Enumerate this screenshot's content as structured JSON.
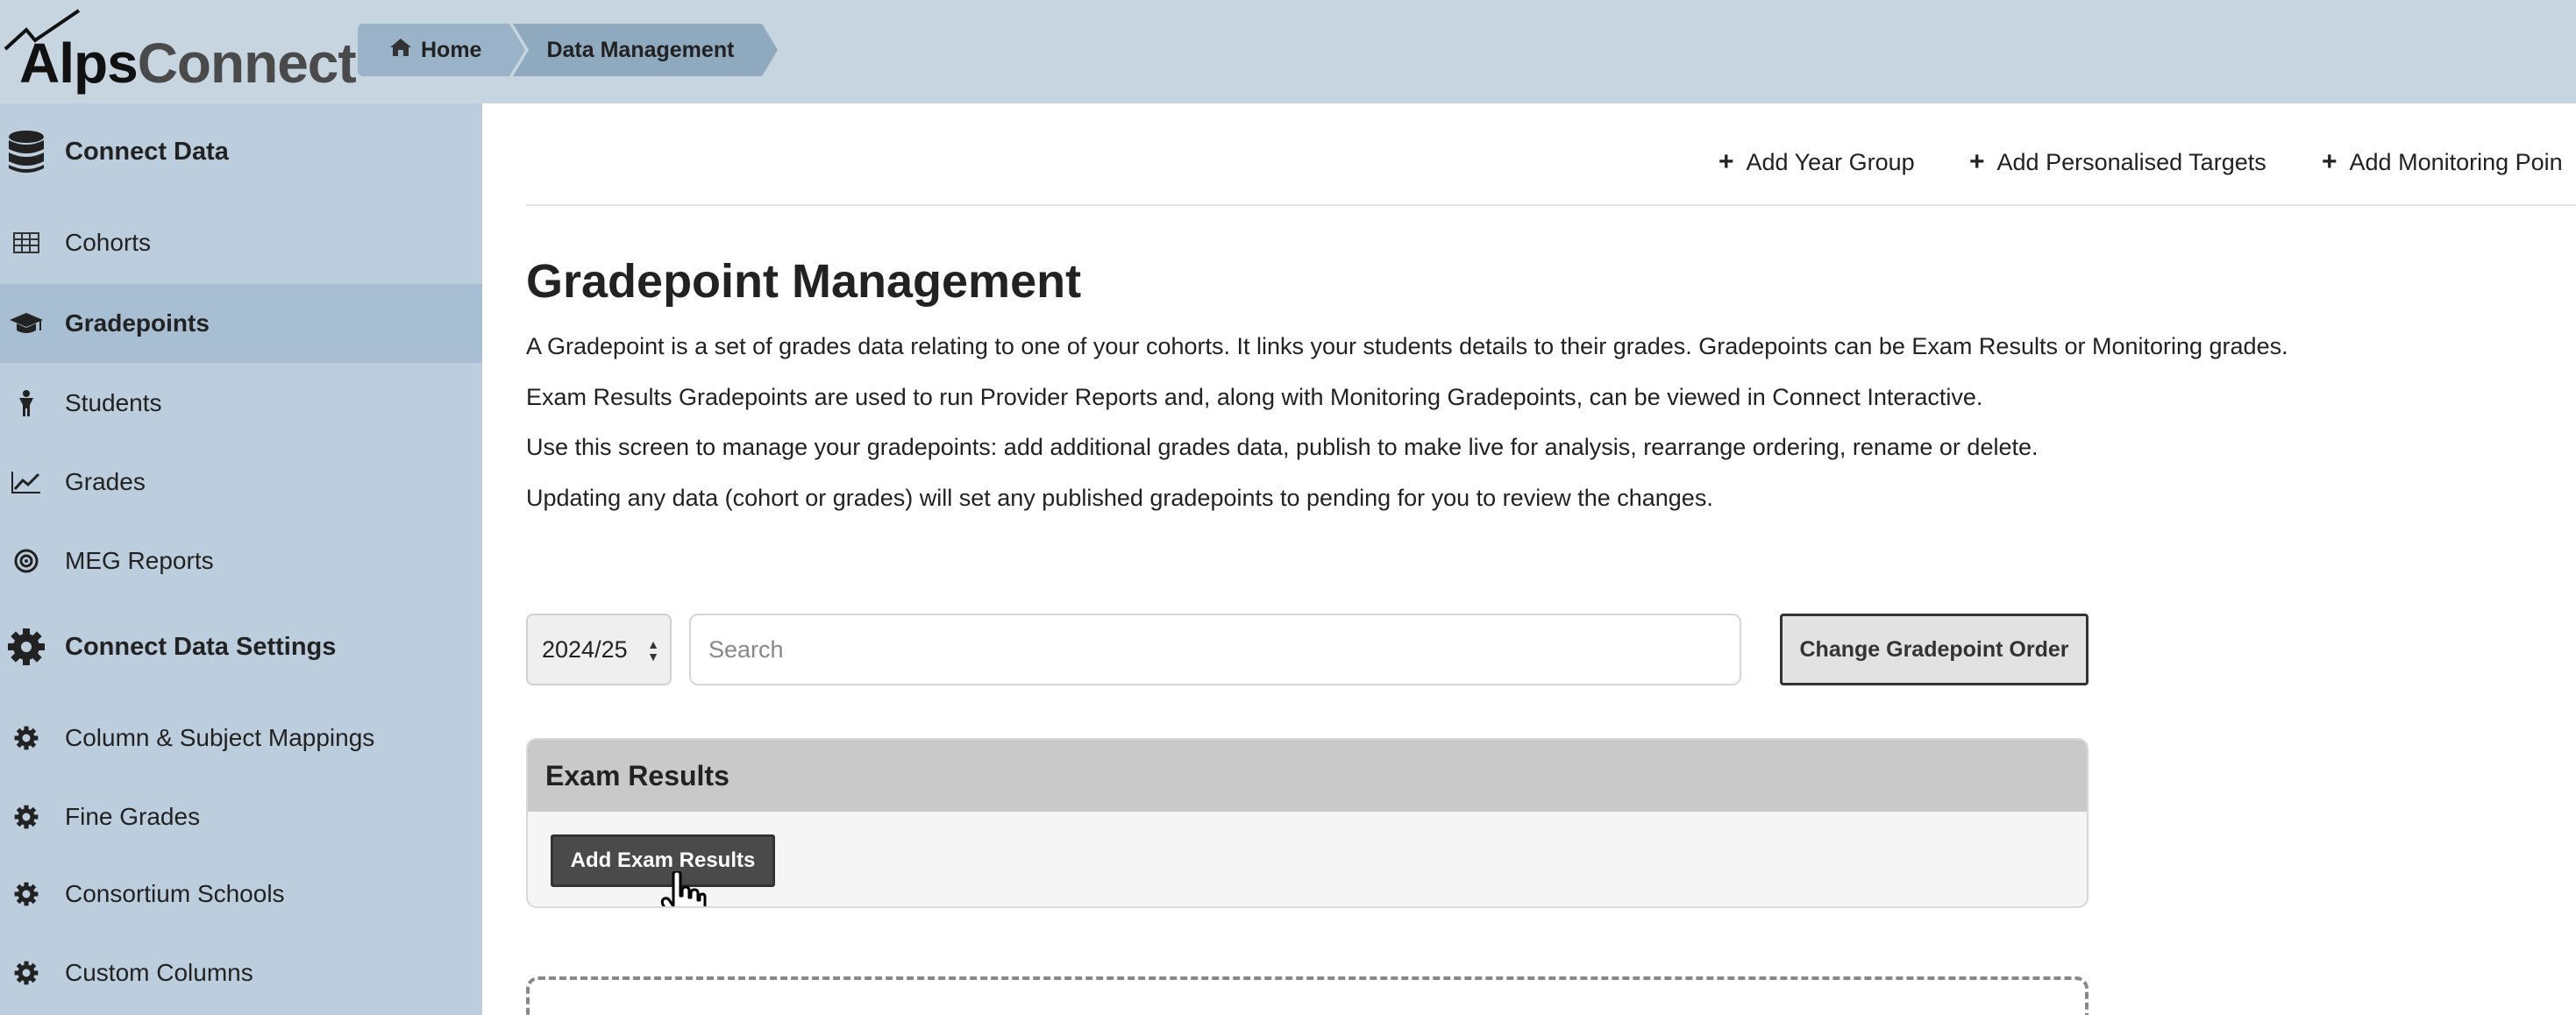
{
  "app": {
    "logo_text_1": "Alps",
    "logo_text_2": "Connect"
  },
  "breadcrumb": {
    "home": "Home",
    "current": "Data Management"
  },
  "sidebar": {
    "items": [
      {
        "label": "Connect Data",
        "icon": "database-icon",
        "type": "header"
      },
      {
        "label": "Cohorts",
        "icon": "table-icon",
        "type": "item"
      },
      {
        "label": "Gradepoints",
        "icon": "graduation-cap-icon",
        "type": "item",
        "active": true
      },
      {
        "label": "Students",
        "icon": "student-icon",
        "type": "item"
      },
      {
        "label": "Grades",
        "icon": "line-chart-icon",
        "type": "item"
      },
      {
        "label": "MEG Reports",
        "icon": "target-icon",
        "type": "item"
      },
      {
        "label": "Connect Data Settings",
        "icon": "gear-icon",
        "type": "header"
      },
      {
        "label": "Column & Subject Mappings",
        "icon": "gear-icon",
        "type": "item"
      },
      {
        "label": "Fine Grades",
        "icon": "gear-icon",
        "type": "item"
      },
      {
        "label": "Consortium Schools",
        "icon": "gear-icon",
        "type": "item"
      },
      {
        "label": "Custom Columns",
        "icon": "gear-icon",
        "type": "item"
      }
    ]
  },
  "actions": {
    "add_year_group": "Add Year Group",
    "add_personalised_targets": "Add Personalised Targets",
    "add_monitoring_point": "Add Monitoring Poin"
  },
  "main": {
    "title": "Gradepoint Management",
    "paragraphs": [
      "A Gradepoint is a set of grades data relating to one of your cohorts. It links your students details to their grades. Gradepoints can be Exam Results or Monitoring grades.",
      "Exam Results Gradepoints are used to run Provider Reports and, along with Monitoring Gradepoints, can be viewed in Connect Interactive.",
      "Use this screen to manage your gradepoints: add additional grades data, publish to make live for analysis, rearrange ordering, rename or delete.",
      "Updating any data (cohort or grades) will set any published gradepoints to pending for you to review the changes."
    ],
    "year_select": "2024/25",
    "search_placeholder": "Search",
    "change_order_label": "Change Gradepoint Order",
    "exam_results_heading": "Exam Results",
    "add_exam_results_label": "Add Exam Results"
  },
  "colors": {
    "topbar": "#c7d5e0",
    "sidebar": "#bccedd",
    "sidebar_active": "#a8bfd3",
    "breadcrumb": "#9ab3c8",
    "panel_header": "#c9c9c9",
    "primary_button": "#4a4a4a"
  }
}
